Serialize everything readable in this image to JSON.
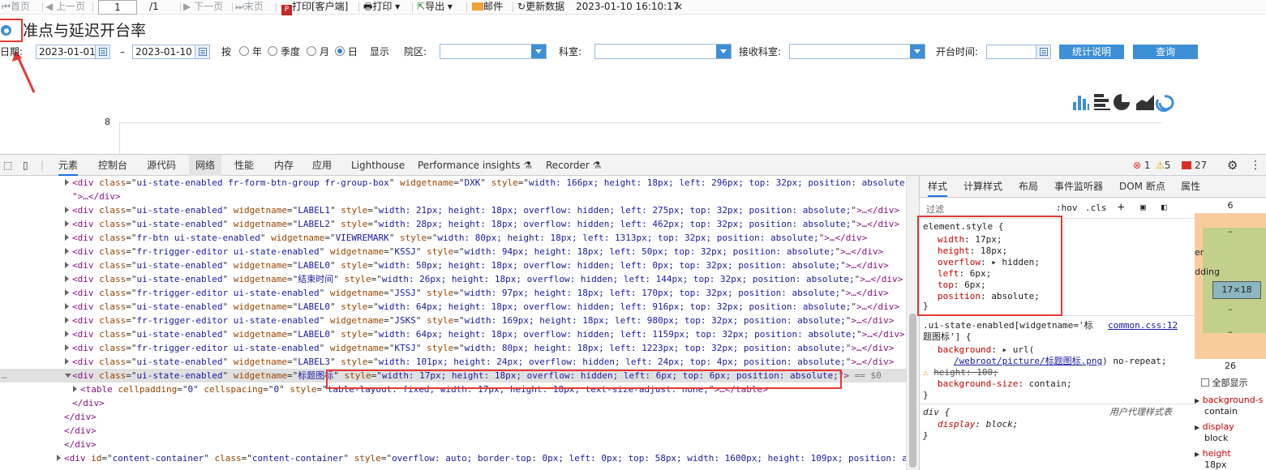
{
  "report_toolbar": {
    "first": "首页",
    "prev": "上一页",
    "page_current": "1",
    "page_total": "/1",
    "next": "下一页",
    "last": "末页",
    "print_client": "打印[客户端]",
    "print": "打印",
    "export": "导出",
    "mail": "邮件",
    "refresh": "更新数据",
    "timestamp": "2023-01-10 16:10:17",
    "close": "×"
  },
  "report": {
    "title": "准点与延迟开台率",
    "date_label": "日期:",
    "start_date": "2023-01-01",
    "dash": "–",
    "end_date": "2023-01-10",
    "by_label": "按",
    "period_options": [
      "年",
      "季度",
      "月",
      "日"
    ],
    "selected_period": "日",
    "show_label": "显示",
    "campus_label": "院区:",
    "dept_label": "科室:",
    "receiving_dept_label": "接收科室:",
    "start_time_label": "开台时间:",
    "explain_button": "统计说明",
    "query_button": "查询",
    "y_tick": "8"
  },
  "devtools": {
    "tabs": [
      "元素",
      "控制台",
      "源代码",
      "网络",
      "性能",
      "内存",
      "应用",
      "Lighthouse",
      "Performance insights ⚗",
      "Recorder ⚗"
    ],
    "active_tab": "元素",
    "error_count": "1",
    "warning_count": "5",
    "issue_count": "27",
    "dom_lines": [
      {
        "indent": 1,
        "arrow": "r",
        "tag": "div",
        "attrs": [
          [
            "class",
            "ui-state-enabled fr-form-btn-group fr-group-box"
          ],
          [
            "widgetname",
            "DXK"
          ],
          [
            "style",
            "width: 166px; height: 18px; left: 296px; top: 32px; position: absolute;"
          ]
        ],
        "tail": ""
      },
      {
        "indent": 1,
        "arrow": "",
        "tag": "",
        "attrs": [],
        "tail": "\">…</div>"
      },
      {
        "indent": 1,
        "arrow": "r",
        "tag": "div",
        "attrs": [
          [
            "class",
            "ui-state-enabled"
          ],
          [
            "widgetname",
            "LABEL1"
          ],
          [
            "style",
            "width: 21px; height: 18px; overflow: hidden; left: 275px; top: 32px; position: absolute;"
          ]
        ],
        "tail": ">…</div>"
      },
      {
        "indent": 1,
        "arrow": "r",
        "tag": "div",
        "attrs": [
          [
            "class",
            "ui-state-enabled"
          ],
          [
            "widgetname",
            "LABEL2"
          ],
          [
            "style",
            "width: 28px; height: 18px; overflow: hidden; left: 462px; top: 32px; position: absolute;"
          ]
        ],
        "tail": ">…</div>"
      },
      {
        "indent": 1,
        "arrow": "r",
        "tag": "div",
        "attrs": [
          [
            "class",
            "fr-btn ui-state-enabled"
          ],
          [
            "widgetname",
            "VIEWREMARK"
          ],
          [
            "style",
            "width: 80px; height: 18px; left: 1313px; top: 32px; position: absolute;"
          ]
        ],
        "tail": ">…</div>"
      },
      {
        "indent": 1,
        "arrow": "r",
        "tag": "div",
        "attrs": [
          [
            "class",
            "fr-trigger-editor ui-state-enabled"
          ],
          [
            "widgetname",
            "KSSJ"
          ],
          [
            "style",
            "width: 94px; height: 18px; left: 50px; top: 32px; position: absolute;"
          ]
        ],
        "tail": ">…</div>"
      },
      {
        "indent": 1,
        "arrow": "r",
        "tag": "div",
        "attrs": [
          [
            "class",
            "ui-state-enabled"
          ],
          [
            "widgetname",
            "LABEL0"
          ],
          [
            "style",
            "width: 50px; height: 18px; overflow: hidden; left: 0px; top: 32px; position: absolute;"
          ]
        ],
        "tail": ">…</div>"
      },
      {
        "indent": 1,
        "arrow": "r",
        "tag": "div",
        "attrs": [
          [
            "class",
            "ui-state-enabled"
          ],
          [
            "widgetname",
            "结束时间"
          ],
          [
            "style",
            "width: 26px; height: 18px; overflow: hidden; left: 144px; top: 32px; position: absolute;"
          ]
        ],
        "tail": ">…</div>"
      },
      {
        "indent": 1,
        "arrow": "r",
        "tag": "div",
        "attrs": [
          [
            "class",
            "fr-trigger-editor ui-state-enabled"
          ],
          [
            "widgetname",
            "JSSJ"
          ],
          [
            "style",
            "width: 97px; height: 18px; left: 170px; top: 32px; position: absolute;"
          ]
        ],
        "tail": ">…</div>"
      },
      {
        "indent": 1,
        "arrow": "r",
        "tag": "div",
        "attrs": [
          [
            "class",
            "ui-state-enabled"
          ],
          [
            "widgetname",
            "LABEL0"
          ],
          [
            "style",
            "width: 64px; height: 18px; overflow: hidden; left: 916px; top: 32px; position: absolute;"
          ]
        ],
        "tail": ">…</div>"
      },
      {
        "indent": 1,
        "arrow": "r",
        "tag": "div",
        "attrs": [
          [
            "class",
            "fr-trigger-editor ui-state-enabled"
          ],
          [
            "widgetname",
            "JSKS"
          ],
          [
            "style",
            "width: 169px; height: 18px; left: 980px; top: 32px; position: absolute;"
          ]
        ],
        "tail": ">…</div>"
      },
      {
        "indent": 1,
        "arrow": "r",
        "tag": "div",
        "attrs": [
          [
            "class",
            "ui-state-enabled"
          ],
          [
            "widgetname",
            "LABEL0"
          ],
          [
            "style",
            "width: 64px; height: 18px; overflow: hidden; left: 1159px; top: 32px; position: absolute;"
          ]
        ],
        "tail": ">…</div>"
      },
      {
        "indent": 1,
        "arrow": "r",
        "tag": "div",
        "attrs": [
          [
            "class",
            "fr-trigger-editor ui-state-enabled"
          ],
          [
            "widgetname",
            "KTSJ"
          ],
          [
            "style",
            "width: 80px; height: 18px; left: 1223px; top: 32px; position: absolute;"
          ]
        ],
        "tail": ">…</div>"
      },
      {
        "indent": 1,
        "arrow": "r",
        "tag": "div",
        "attrs": [
          [
            "class",
            "ui-state-enabled"
          ],
          [
            "widgetname",
            "LABEL3"
          ],
          [
            "style",
            "width: 101px; height: 24px; overflow: hidden; left: 24px; top: 4px; position: absolute;"
          ]
        ],
        "tail": ">…</div>"
      },
      {
        "indent": 1,
        "arrow": "d",
        "tag": "div",
        "attrs": [
          [
            "class",
            "ui-state-enabled"
          ],
          [
            "widgetname",
            "标题图标"
          ],
          [
            "style",
            "width: 17px; height: 18px; overflow: hidden; left: 6px; top: 6px; position: absolute;"
          ]
        ],
        "tail": "> == $0",
        "selected": true
      },
      {
        "indent": 2,
        "arrow": "r",
        "tag": "table",
        "attrs": [
          [
            "cellpadding",
            "0"
          ],
          [
            "cellspacing",
            "0"
          ],
          [
            "style",
            "table-layout: fixed; width: 17px; height: 18px; text-size-adjust: none;"
          ]
        ],
        "tail": ">…</table>"
      },
      {
        "indent": 1,
        "arrow": "",
        "tag": "",
        "attrs": [],
        "tail": "</div>"
      },
      {
        "indent": 0,
        "arrow": "",
        "tag": "",
        "attrs": [],
        "tail": "  </div>"
      },
      {
        "indent": 0,
        "arrow": "",
        "tag": "",
        "attrs": [],
        "tail": " </div>"
      },
      {
        "indent": 0,
        "arrow": "",
        "tag": "",
        "attrs": [],
        "tail": "</div>"
      },
      {
        "indent": 0,
        "arrow": "r",
        "tag": "div",
        "attrs": [
          [
            "id",
            "content-container"
          ],
          [
            "class",
            "content-container"
          ],
          [
            "style",
            "overflow: auto; border-top: 0px; left: 0px; top: 58px; width: 1600px; height: 109px; position: absolu"
          ]
        ],
        "tail": ""
      }
    ],
    "styles_tabs": [
      "样式",
      "计算样式",
      "布局",
      "事件监听器",
      "DOM 断点",
      "属性",
      "无障碍功能"
    ],
    "active_styles_tab": "样式",
    "filter_placeholder": "过滤",
    "filter_tools": [
      ":hov",
      ".cls",
      "+"
    ],
    "element_style_selector": "element.style {",
    "element_style": [
      [
        "width",
        "17px;"
      ],
      [
        "height",
        "18px;"
      ],
      [
        "overflow",
        "▸ hidden;"
      ],
      [
        "left",
        "6px;"
      ],
      [
        "top",
        "6px;"
      ],
      [
        "position",
        "absolute;"
      ]
    ],
    "close_brace": "}",
    "rule2_selector": ".ui-state-enabled[widgetname='标",
    "rule2_selector_cont": "题图标'] {",
    "rule2_source": "common.css:12",
    "rule2_bg_prop": "background",
    "rule2_bg_prefix": "▸ url(",
    "rule2_bg_url": "/webroot/picture/标题图标.png",
    "rule2_bg_suffix": ") no-repeat;",
    "rule2_height_struck": "height: 100;",
    "rule2_bgsize_prop": "background-size",
    "rule2_bgsize_val": "contain;",
    "rule3_selector": "div {",
    "rule3_source": "用户代理样式表",
    "rule3_prop": "display",
    "rule3_val": "block;",
    "boxmodel": {
      "margin_top": "6",
      "margin_label": "er",
      "padding_label": "dding",
      "dash": "–",
      "content": "17×18",
      "bottom": "26",
      "show_all": "全部显示"
    },
    "computed_list": [
      [
        "background-s",
        "contain"
      ],
      [
        "display",
        "block"
      ],
      [
        "height",
        "18px"
      ]
    ]
  },
  "colors": {
    "accent": "#1a73e8",
    "button_blue": "#3d8fd6",
    "highlight_red": "#e53935"
  }
}
